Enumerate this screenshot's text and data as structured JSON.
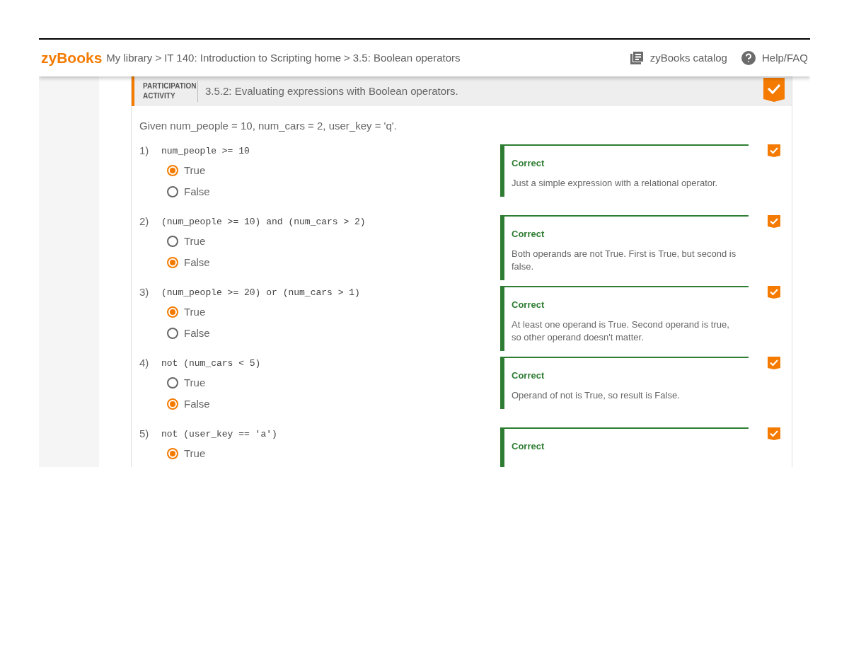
{
  "header": {
    "logo": "zyBooks",
    "breadcrumb": {
      "items": [
        "My library",
        "IT 140: Introduction to Scripting home",
        "3.5: Boolean operators"
      ],
      "separators": [
        ">",
        ">"
      ]
    },
    "links": [
      "zyBooks catalog",
      "Help/FAQ"
    ]
  },
  "activity": {
    "type_label": "PARTICIPATION ACTIVITY",
    "title": "3.5.2: Evaluating expressions with Boolean operators.",
    "completed": true,
    "prompt": "Given num_people = 10, num_cars = 2, user_key = 'q'.",
    "questions": [
      {
        "number": "1)",
        "expression": "num_people >= 10",
        "options": [
          {
            "label": "True",
            "selected": true
          },
          {
            "label": "False",
            "selected": false
          }
        ],
        "feedback": {
          "correct": true,
          "title": "Correct",
          "explanation": "Just a simple expression with a relational operator."
        },
        "done": true
      },
      {
        "number": "2)",
        "expression": "(num_people >= 10) and (num_cars > 2)",
        "options": [
          {
            "label": "True",
            "selected": false
          },
          {
            "label": "False",
            "selected": true
          }
        ],
        "feedback": {
          "correct": true,
          "title": "Correct",
          "explanation": "Both operands are not True. First is True, but second is false."
        },
        "done": true
      },
      {
        "number": "3)",
        "expression": "(num_people >= 20) or (num_cars > 1)",
        "options": [
          {
            "label": "True",
            "selected": true
          },
          {
            "label": "False",
            "selected": false
          }
        ],
        "feedback": {
          "correct": true,
          "title": "Correct",
          "explanation": "At least one operand is True. Second operand is true, so other operand doesn't matter."
        },
        "done": true
      },
      {
        "number": "4)",
        "expression": "not (num_cars < 5)",
        "options": [
          {
            "label": "True",
            "selected": false
          },
          {
            "label": "False",
            "selected": true
          }
        ],
        "feedback": {
          "correct": true,
          "title": "Correct",
          "explanation": "Operand of not is True, so result is False."
        },
        "done": true
      },
      {
        "number": "5)",
        "expression": "not (user_key == 'a')",
        "options": [
          {
            "label": "True",
            "selected": true
          }
        ],
        "feedback": {
          "correct": true,
          "title": "Correct"
        },
        "done": true
      }
    ]
  }
}
